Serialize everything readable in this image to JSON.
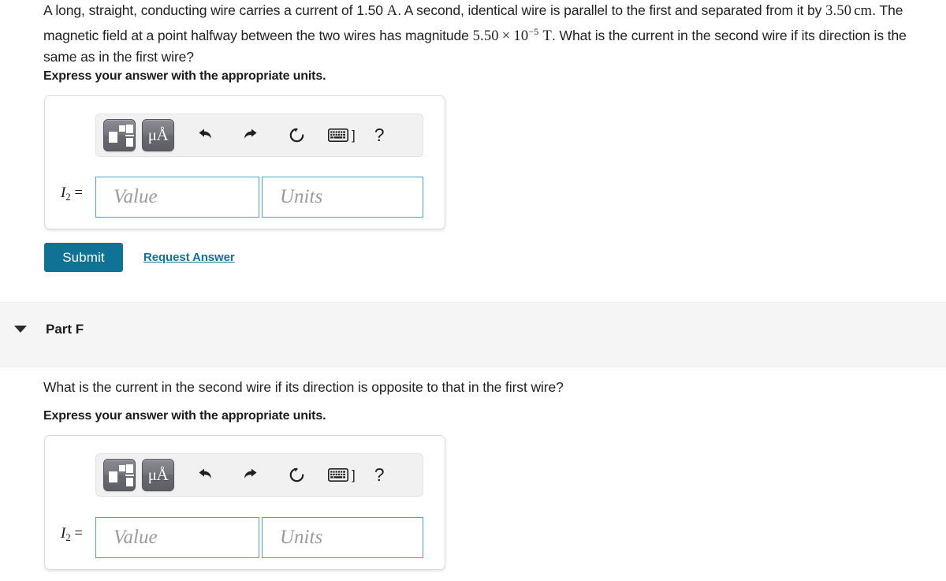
{
  "question": {
    "line1_a": "A long, straight, conducting wire carries a current of 1.50 ",
    "line1_unit": "A",
    "line1_b": ". A second, identical wire is parallel to the first and separated from it by",
    "line2_value": "3.50",
    "line2_unit": "cm",
    "line2_a": ". The magnetic field at a point halfway between the two wires has magnitude ",
    "line2_mag_mantissa": "5.50",
    "line2_mag_times": "×",
    "line2_mag_base": "10",
    "line2_mag_exp": "−5",
    "line2_mag_unit": "T",
    "line2_b": ". What is the current in the second",
    "line3": "wire if its direction is the same as in the first wire?"
  },
  "instruction_e": "Express your answer with the appropriate units.",
  "answer_e": {
    "toolbar": {
      "template_button": "math-template",
      "units_button": "μÅ",
      "undo_button": "undo",
      "redo_button": "redo",
      "reset_button": "reset",
      "keyboard_button": "keyboard-shortcuts",
      "keyboard_bracket": "]",
      "help_button": "?"
    },
    "label_var": "I",
    "label_sub": "2",
    "label_eq": " =",
    "value_placeholder": "Value",
    "units_placeholder": "Units"
  },
  "actions_e": {
    "submit_label": "Submit",
    "request_answer_label": "Request Answer"
  },
  "part_f": {
    "title": "Part F",
    "caret": "collapse-caret",
    "question": "What is the current in the second wire if its direction is opposite to that in the first wire?",
    "instruction": "Express your answer with the appropriate units.",
    "answer": {
      "toolbar": {
        "template_button": "math-template",
        "units_button": "μÅ",
        "undo_button": "undo",
        "redo_button": "redo",
        "reset_button": "reset",
        "keyboard_button": "keyboard-shortcuts",
        "keyboard_bracket": "]",
        "help_button": "?"
      },
      "label_var": "I",
      "label_sub": "2",
      "label_eq": " =",
      "value_placeholder": "Value",
      "units_placeholder": "Units"
    }
  },
  "colors": {
    "submit_bg": "#107294",
    "link": "#12729a",
    "field_border": "#4fa3bc",
    "band_bg": "#f5f5f5"
  }
}
